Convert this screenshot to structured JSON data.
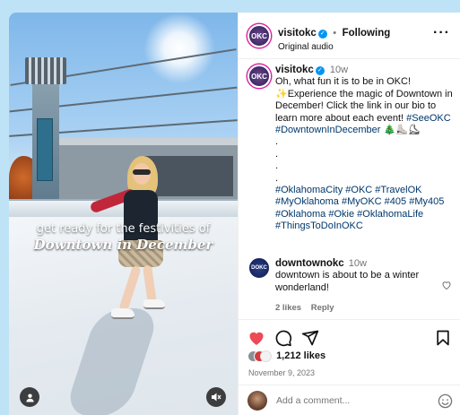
{
  "media": {
    "caption_line1": "get ready for the festivities of",
    "caption_line2": "Downtown in December"
  },
  "header": {
    "avatar_text": "OKC",
    "username": "visitokc",
    "separator": "•",
    "follow_status": "Following",
    "audio": "Original audio"
  },
  "post": {
    "avatar_text": "OKC",
    "username": "visitokc",
    "age": "10w",
    "text_line1": "Oh, what fun it is to be in OKC!",
    "text_line2": "✨Experience the magic of Downtown in December! Click the link in our bio to learn more about each event!",
    "hashtag_seeokc": "#SeeOKC",
    "hashtag_downtown": "#DowntownInDecember",
    "emoji": "🎄⛸️⛸",
    "dots": [
      ".",
      ".",
      ".",
      "."
    ],
    "hashtags": [
      "#OklahomaCity",
      "#OKC",
      "#TravelOK",
      "#MyOklahoma",
      "#MyOKC",
      "#405",
      "#My405",
      "#Oklahoma",
      "#Okie",
      "#OklahomaLife",
      "#ThingsToDoInOKC"
    ]
  },
  "comment": {
    "avatar_text": "DOKC",
    "username": "downtownokc",
    "age": "10w",
    "text": "downtown is about to be a winter wonderland!",
    "likes": "2 likes",
    "reply": "Reply"
  },
  "actions": {
    "likes_count": "1,212 likes",
    "date": "November 9, 2023",
    "add_comment_placeholder": "Add a comment..."
  },
  "colors": {
    "heart": "#ed4956",
    "link": "#00376b",
    "verified": "#0095f6"
  }
}
